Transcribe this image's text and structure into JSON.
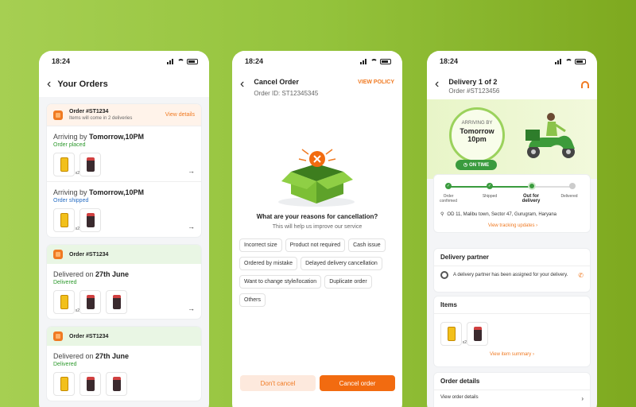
{
  "status_time": "18:24",
  "screen1": {
    "title": "Your Orders",
    "cards": [
      {
        "order": "Order #ST1234",
        "sub": "Items will come in 2 deliveries",
        "link": "View details",
        "deliveries": [
          {
            "prefix": "Arriving by ",
            "when": "Tomorrow,10PM",
            "status": "Order placed"
          },
          {
            "prefix": "Arriving by ",
            "when": "Tomorrow,10PM",
            "status": "Order shipped"
          }
        ]
      },
      {
        "order": "Order #ST1234",
        "deliveries": [
          {
            "prefix": "Delivered on ",
            "when": "27th June",
            "status": "Delivered"
          }
        ]
      },
      {
        "order": "Order #ST1234",
        "deliveries": [
          {
            "prefix": "Delivered on ",
            "when": "27th June",
            "status": "Delivered"
          }
        ]
      }
    ],
    "qty": "x2"
  },
  "screen2": {
    "title": "Cancel Order",
    "order_id": "Order ID: ST12345345",
    "view_policy": "VIEW POLICY",
    "question": "What are your reasons for cancellation?",
    "sub": "This will help us improve our service",
    "reasons": [
      "Incorrect size",
      "Product not required",
      "Cash issue",
      "Ordered by mistake",
      "Delayed delivery cancellation",
      "Want to change style/location",
      "Duplicate order",
      "Others"
    ],
    "dont_cancel": "Don't cancel",
    "cancel_order": "Cancel order"
  },
  "screen3": {
    "title": "Delivery 1 of 2",
    "order": "Order #ST123456",
    "arriving_label": "ARRIVING BY",
    "arriving_day": "Tomorrow",
    "arriving_time": "10pm",
    "on_time": "ON TIME",
    "steps": [
      "Order confirmed",
      "Shipped",
      "Out for delivery",
      "Delivered"
    ],
    "address": "OD 11, Malibu town, Sector 47, Gurugram, Haryana",
    "tracking_link": "View tracking updates ›",
    "partner_title": "Delivery partner",
    "partner_text": "A delivery partner has been assigned for your delivery.",
    "items_title": "Items",
    "items_link": "View item summary ›",
    "qty": "x2",
    "order_details_title": "Order details",
    "view_order_details": "View order details",
    "chevron": "›"
  },
  "colors": {
    "accent": "#f07a22",
    "success": "#3a9b3e",
    "info": "#2a6fc4"
  }
}
